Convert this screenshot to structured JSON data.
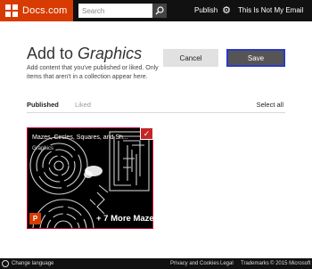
{
  "header": {
    "brand": "Docs.com",
    "search_placeholder": "Search",
    "publish": "Publish",
    "account": "This Is Not My Email"
  },
  "page": {
    "title_prefix": "Add to ",
    "title_collection": "Graphics",
    "description": "Add content that you've published or liked. Only items that aren't in a collection appear here.",
    "cancel_label": "Cancel",
    "save_label": "Save"
  },
  "tabs": [
    {
      "label": "Published",
      "active": true
    },
    {
      "label": "Liked",
      "active": false
    }
  ],
  "select_all": "Select all",
  "card": {
    "title": "Mazes, Circles, Squares, and Sh...",
    "subtitle": "Graphics",
    "check": "✓",
    "more": "+ 7 More Mazes",
    "app_badge": "P",
    "selected": true
  },
  "footer": {
    "change_language": "Change language",
    "privacy": "Privacy and Cookies",
    "legal": "Legal",
    "trademarks": "Trademarks",
    "copyright": "© 2015 Microsoft"
  },
  "colors": {
    "brand": "#d83b01",
    "topbar": "#111111",
    "save_button": "#555555",
    "save_border": "#2b3ac7",
    "selected_border": "#c42727"
  }
}
